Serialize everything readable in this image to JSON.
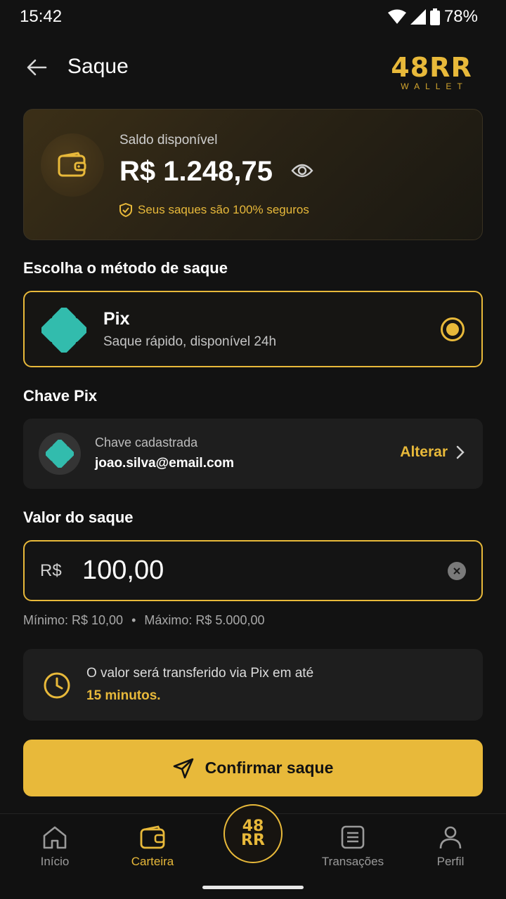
{
  "status_bar": {
    "time": "15:42",
    "battery": "78%"
  },
  "header": {
    "title": "Saque",
    "logo_main": "48RR",
    "logo_sub": "WALLET"
  },
  "balance": {
    "label": "Saldo disponível",
    "value": "R$ 1.248,75",
    "secure_text": "Seus saques são 100% seguros"
  },
  "method": {
    "section_title": "Escolha o método de saque",
    "name": "Pix",
    "description": "Saque rápido, disponível 24h",
    "selected": true
  },
  "pix_key": {
    "section_title": "Chave Pix",
    "label": "Chave cadastrada",
    "value": "joao.silva@email.com",
    "change_label": "Alterar"
  },
  "amount": {
    "section_title": "Valor do saque",
    "currency": "R$",
    "value": "100,00",
    "min": "Mínimo: R$ 10,00",
    "separator": "•",
    "max": "Máximo: R$ 5.000,00"
  },
  "info": {
    "text": "O valor será transferido via Pix em até",
    "highlight": "15 minutos."
  },
  "confirm_label": "Confirmar saque",
  "nav": {
    "items": [
      {
        "label": "Início",
        "icon": "home-icon"
      },
      {
        "label": "Carteira",
        "icon": "wallet-icon"
      },
      {
        "label": "Transações",
        "icon": "list-icon"
      },
      {
        "label": "Perfil",
        "icon": "user-icon"
      }
    ],
    "center_top": "48",
    "center_bottom": "RR"
  },
  "colors": {
    "accent": "#e8b93a",
    "background": "#121212",
    "pix": "#32bcad"
  }
}
